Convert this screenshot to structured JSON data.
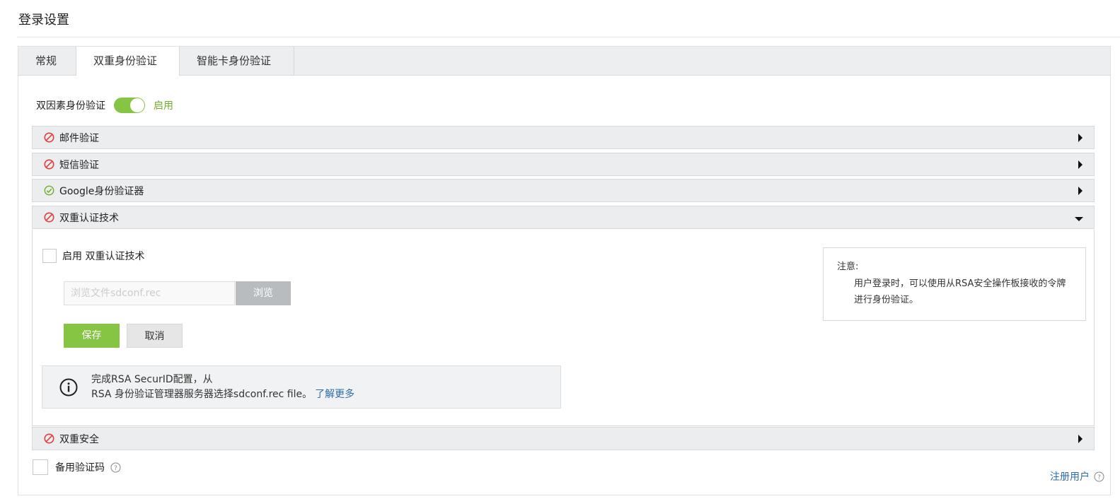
{
  "page": {
    "title": "登录设置"
  },
  "tabs": [
    {
      "label": "常规",
      "active": false
    },
    {
      "label": "双重身份验证",
      "active": true
    },
    {
      "label": "智能卡身份验证",
      "active": false
    }
  ],
  "two_factor": {
    "label": "双因素身份验证",
    "state_label": "启用",
    "enabled": true
  },
  "methods": [
    {
      "label": "邮件验证",
      "status": "disabled",
      "expanded": false
    },
    {
      "label": "短信验证",
      "status": "disabled",
      "expanded": false
    },
    {
      "label": "Google身份验证器",
      "status": "enabled",
      "expanded": false
    },
    {
      "label": "双重认证技术",
      "status": "disabled",
      "expanded": true
    },
    {
      "label": "双重安全",
      "status": "disabled",
      "expanded": false
    }
  ],
  "rsa": {
    "enable_label": "启用 双重认证技术",
    "enable_checked": false,
    "file_placeholder": "浏览文件sdconf.rec",
    "browse_label": "浏览",
    "save_label": "保存",
    "cancel_label": "取消",
    "info_line1": "完成RSA SecurID配置，从",
    "info_line2": "RSA 身份验证管理器服务器选择sdconf.rec file。",
    "info_link": "了解更多",
    "note_title": "注意:",
    "note_text": "用户登录时，可以使用从RSA安全操作板接收的令牌进行身份验证。"
  },
  "backup": {
    "label": "备用验证码",
    "checked": false
  },
  "register": {
    "label": "注册用户"
  },
  "colors": {
    "accent_green": "#86c443",
    "link_blue": "#2f6da8",
    "disabled_red": "#e23c3c",
    "enabled_green": "#6fae2a"
  }
}
